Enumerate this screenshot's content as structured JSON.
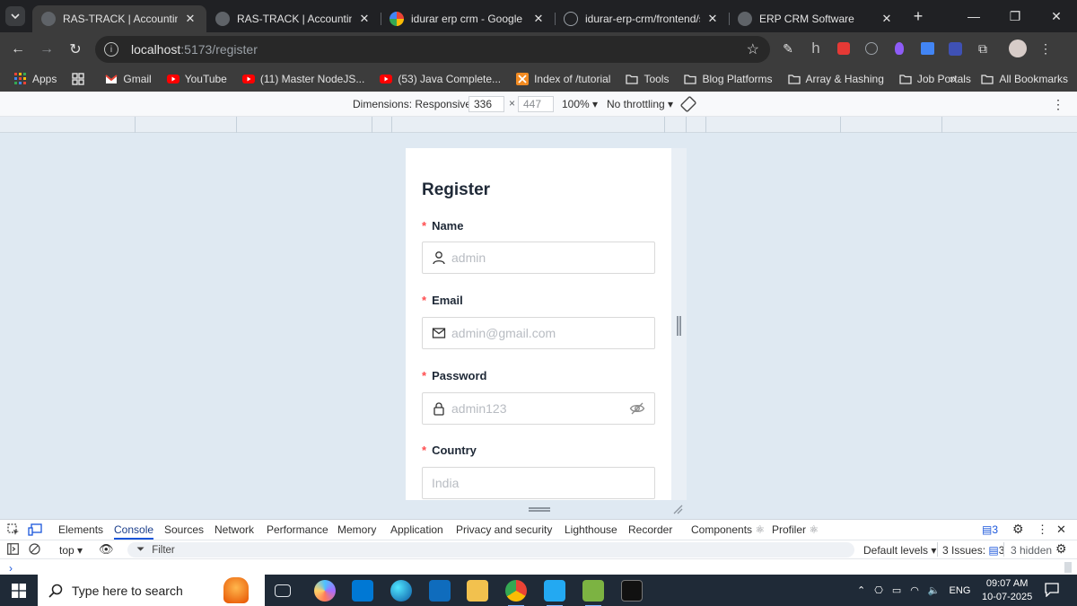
{
  "browser": {
    "tabs": [
      {
        "title": "RAS-TRACK | Accounting Inv",
        "active": true
      },
      {
        "title": "RAS-TRACK | Accounting Inv",
        "active": false
      },
      {
        "title": "idurar erp crm - Google Sear",
        "active": false
      },
      {
        "title": "idurar-erp-crm/frontend/src",
        "active": false
      },
      {
        "title": "ERP CRM Software",
        "active": false
      }
    ],
    "url_host": "localhost",
    "url_path": ":5173/register"
  },
  "bookmarks": {
    "items": [
      "Apps",
      "Gmail",
      "YouTube",
      "(11) Master NodeJS...",
      "(53) Java Complete...",
      "Index of /tutorial",
      "Tools",
      "Blog Platforms",
      "Array & Hashing",
      "Job Portals"
    ],
    "all_bookmarks": "All Bookmarks"
  },
  "device_toolbar": {
    "dimensions_label": "Dimensions: Responsive",
    "width": "336",
    "height": "447",
    "zoom": "100%",
    "throttling": "No throttling"
  },
  "form": {
    "title": "Register",
    "fields": [
      {
        "label": "Name",
        "placeholder": "admin"
      },
      {
        "label": "Email",
        "placeholder": "admin@gmail.com"
      },
      {
        "label": "Password",
        "placeholder": "admin123"
      },
      {
        "label": "Country",
        "placeholder": "India"
      }
    ]
  },
  "devtools": {
    "tabs": [
      "Elements",
      "Console",
      "Sources",
      "Network",
      "Performance",
      "Memory",
      "Application",
      "Privacy and security",
      "Lighthouse",
      "Recorder",
      "Components",
      "Profiler"
    ],
    "active_tab": "Console",
    "message_count": "3",
    "context": "top",
    "filter_placeholder": "Filter",
    "levels": "Default levels",
    "issues_label": "3 Issues:",
    "issues_count": "3",
    "hidden": "3 hidden"
  },
  "taskbar": {
    "search_placeholder": "Type here to search",
    "language": "ENG",
    "time": "09:07 AM",
    "date": "10-07-2025"
  },
  "colors": {
    "page_background": "#dfe9f2",
    "required_asterisk": "#ff4d4f",
    "devtools_active": "#1a56db"
  }
}
